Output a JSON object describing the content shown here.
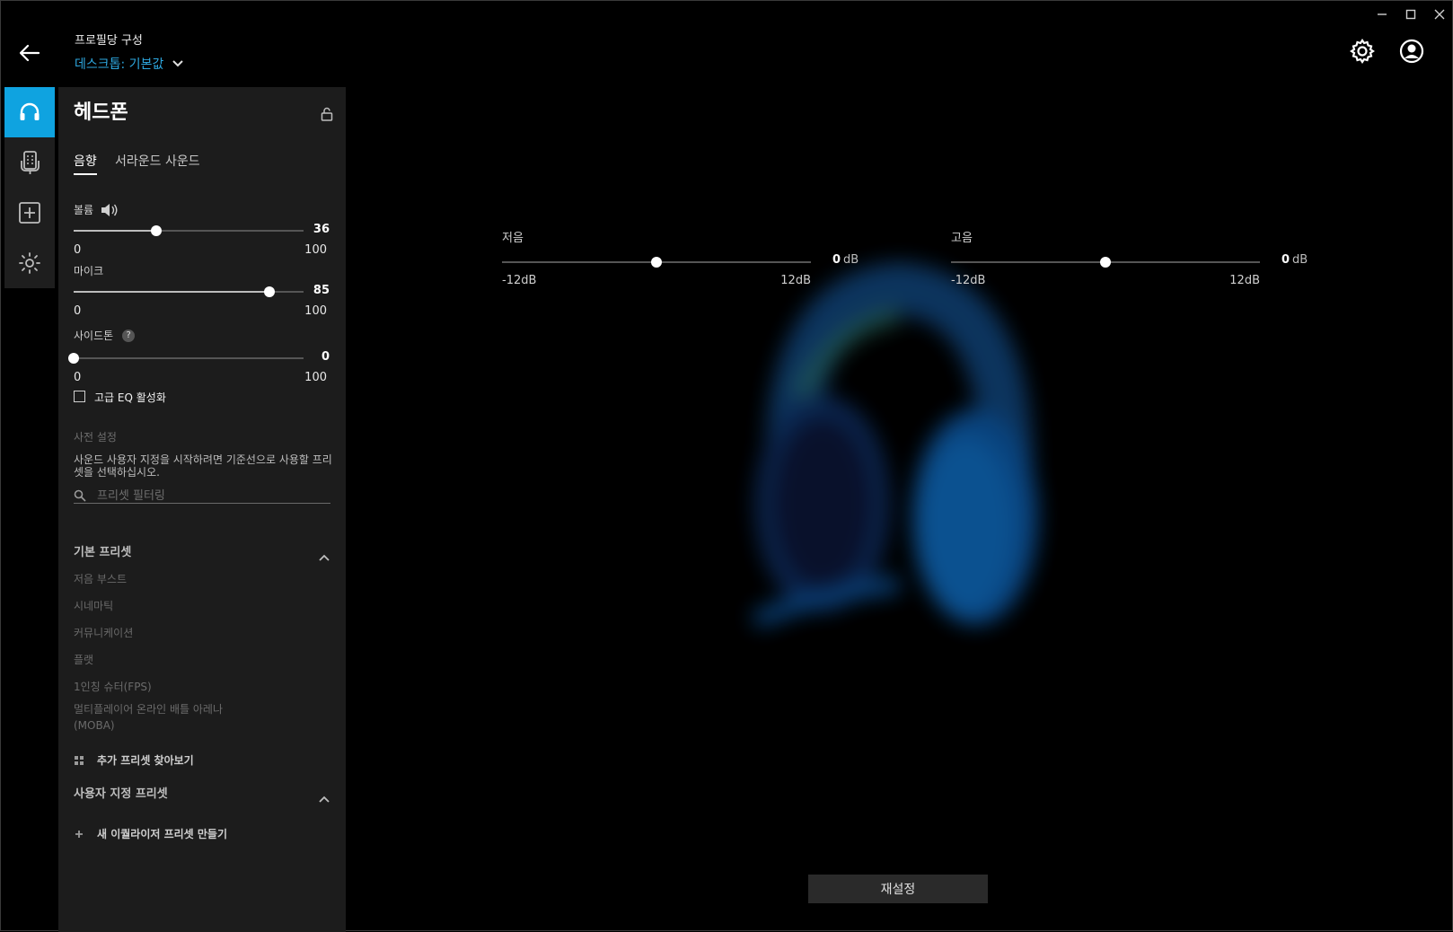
{
  "window": {
    "minimize": "—",
    "maximize": "☐",
    "close": "✕"
  },
  "header": {
    "profile_label": "프로필당 구성",
    "profile_value": "데스크톱: 기본값"
  },
  "rail": {
    "items": [
      "headphones-icon",
      "device-icon",
      "add-icon",
      "brightness-icon"
    ]
  },
  "panel": {
    "title": "헤드폰",
    "tabs": [
      "음향",
      "서라운드 사운드"
    ],
    "volume": {
      "label": "볼륨",
      "value": 36,
      "min": "0",
      "max": "100"
    },
    "mic": {
      "label": "마이크",
      "value": 85,
      "min": "0",
      "max": "100"
    },
    "sidetone": {
      "label": "사이드톤",
      "value": 0,
      "min": "0",
      "max": "100",
      "help": "?"
    },
    "advanced_eq": {
      "label": "고급 EQ 활성화",
      "checked": false
    },
    "presets": {
      "header": "사전 설정",
      "description": "사운드 사용자 지정을 시작하려면 기준선으로 사용할 프리셋을 선택하십시오.",
      "filter_placeholder": "프리셋 필터링",
      "default_title": "기본 프리셋",
      "default_items": [
        "저음 부스트",
        "시네마틱",
        "커뮤니케이션",
        "플랫",
        "1인칭 슈터(FPS)",
        "멀티플레이어 온라인 배틀 아레나(MOBA)"
      ],
      "browse_more": "추가 프리셋 찾아보기",
      "custom_title": "사용자 지정 프리셋",
      "create_new": "새 이퀄라이저 프리셋 만들기"
    }
  },
  "eq": {
    "bass": {
      "label": "저음",
      "value": "0",
      "unit": "dB",
      "min": "-12dB",
      "max": "12dB",
      "level": 0
    },
    "treble": {
      "label": "고음",
      "value": "0",
      "unit": "dB",
      "min": "-12dB",
      "max": "12dB",
      "level": 0
    }
  },
  "reset_label": "재설정",
  "colors": {
    "accent": "#0fa3e0",
    "link": "#2ea8e0",
    "background": "#000000",
    "panel": "#1c1c1c"
  }
}
